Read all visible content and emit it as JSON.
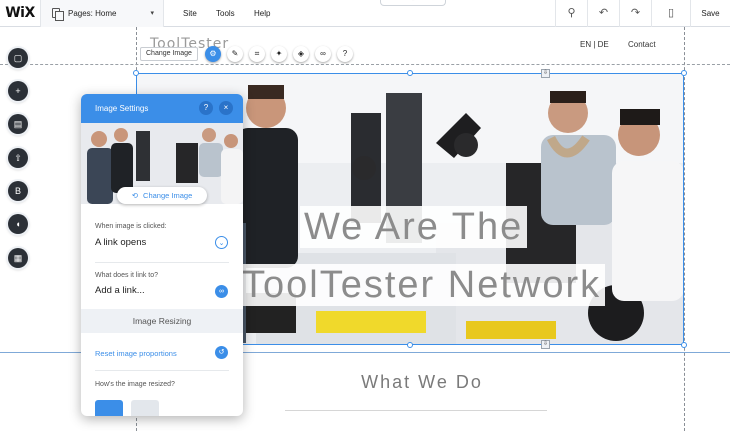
{
  "topbar": {
    "logo": "WiX",
    "pages_label": "Pages: Home",
    "pages_chevron": "▾",
    "menu": [
      "Site",
      "Tools",
      "Help"
    ],
    "notch_glyph": "⌃",
    "icons": [
      "zoom-icon",
      "undo-icon",
      "redo-icon",
      "mobile-icon"
    ],
    "icon_glyphs": [
      "⚲",
      "↶",
      "↷",
      "▯"
    ],
    "save_label": "Save"
  },
  "rail": {
    "buttons": [
      {
        "name": "rail-background-button",
        "glyph": "▢"
      },
      {
        "name": "rail-add-button",
        "glyph": "+"
      },
      {
        "name": "rail-app-market-button",
        "glyph": "▤"
      },
      {
        "name": "rail-upload-button",
        "glyph": "⇧"
      },
      {
        "name": "rail-blog-button",
        "glyph": "B"
      },
      {
        "name": "rail-chat-button",
        "glyph": "◖"
      },
      {
        "name": "rail-bookings-button",
        "glyph": "▦"
      }
    ]
  },
  "site": {
    "logo_text": "ToolTester",
    "lang": "EN | DE",
    "contact": "Contact"
  },
  "image_toolbar": {
    "change_image_label": "Change Image",
    "tools": [
      {
        "name": "settings-gear-icon",
        "glyph": "⚙",
        "active": true
      },
      {
        "name": "pencil-icon",
        "glyph": "✎",
        "active": false
      },
      {
        "name": "crop-icon",
        "glyph": "⌗",
        "active": false
      },
      {
        "name": "filters-icon",
        "glyph": "✦",
        "active": false
      },
      {
        "name": "animation-icon",
        "glyph": "◈",
        "active": false
      },
      {
        "name": "link-icon",
        "glyph": "∞",
        "active": false
      },
      {
        "name": "help-icon",
        "glyph": "?",
        "active": false
      }
    ]
  },
  "hero": {
    "line1": "We Are The",
    "line2": "ToolTester Network"
  },
  "section": {
    "title": "What We Do"
  },
  "panel": {
    "title": "Image Settings",
    "help_glyph": "?",
    "close_glyph": "×",
    "change_image_label": "Change Image",
    "change_image_glyph": "⟲",
    "when_clicked_label": "When image is clicked:",
    "when_clicked_value": "A link opens",
    "chevron_glyph": "⌄",
    "link_label": "What does it link to?",
    "link_value": "Add a link...",
    "link_glyph": "∞",
    "resizing_header": "Image Resizing",
    "reset_label": "Reset image proportions",
    "reset_glyph": "↺",
    "how_resized_label": "How's the image resized?"
  },
  "colors": {
    "accent": "#3b8ee8",
    "rail": "#2b3037"
  }
}
